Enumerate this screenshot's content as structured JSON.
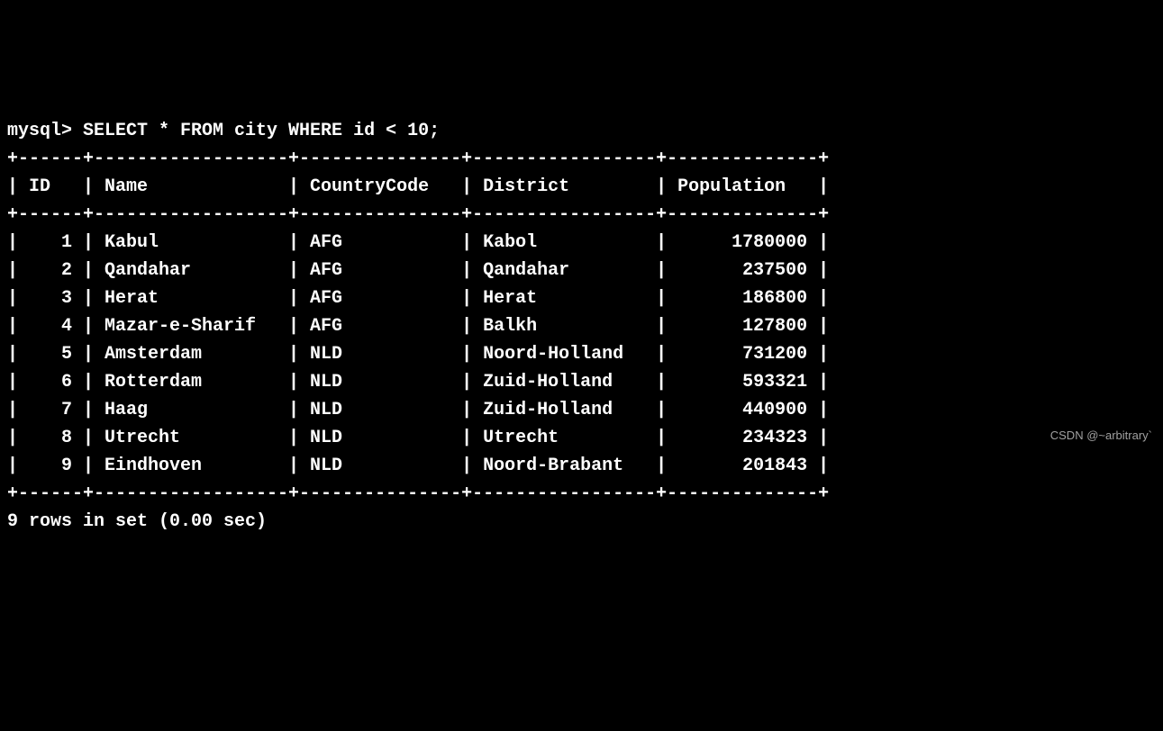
{
  "prompt": "mysql> ",
  "query": "SELECT * FROM city WHERE id < 10;",
  "columns": [
    "ID",
    "Name",
    "CountryCode",
    "District",
    "Population"
  ],
  "rows": [
    {
      "ID": "1",
      "Name": "Kabul",
      "CountryCode": "AFG",
      "District": "Kabol",
      "Population": "1780000"
    },
    {
      "ID": "2",
      "Name": "Qandahar",
      "CountryCode": "AFG",
      "District": "Qandahar",
      "Population": "237500"
    },
    {
      "ID": "3",
      "Name": "Herat",
      "CountryCode": "AFG",
      "District": "Herat",
      "Population": "186800"
    },
    {
      "ID": "4",
      "Name": "Mazar-e-Sharif",
      "CountryCode": "AFG",
      "District": "Balkh",
      "Population": "127800"
    },
    {
      "ID": "5",
      "Name": "Amsterdam",
      "CountryCode": "NLD",
      "District": "Noord-Holland",
      "Population": "731200"
    },
    {
      "ID": "6",
      "Name": "Rotterdam",
      "CountryCode": "NLD",
      "District": "Zuid-Holland",
      "Population": "593321"
    },
    {
      "ID": "7",
      "Name": "Haag",
      "CountryCode": "NLD",
      "District": "Zuid-Holland",
      "Population": "440900"
    },
    {
      "ID": "8",
      "Name": "Utrecht",
      "CountryCode": "NLD",
      "District": "Utrecht",
      "Population": "234323"
    },
    {
      "ID": "9",
      "Name": "Eindhoven",
      "CountryCode": "NLD",
      "District": "Noord-Brabant",
      "Population": "201843"
    }
  ],
  "column_widths": {
    "ID": 4,
    "Name": 16,
    "CountryCode": 13,
    "District": 15,
    "Population": 12
  },
  "column_align": {
    "ID": "right",
    "Name": "left",
    "CountryCode": "left",
    "District": "left",
    "Population": "right"
  },
  "summary": "9 rows in set (0.00 sec)",
  "watermark": "CSDN @~arbitrary`",
  "chart_data": {
    "type": "table",
    "title": "city (id < 10)",
    "columns": [
      "ID",
      "Name",
      "CountryCode",
      "District",
      "Population"
    ],
    "rows": [
      [
        1,
        "Kabul",
        "AFG",
        "Kabol",
        1780000
      ],
      [
        2,
        "Qandahar",
        "AFG",
        "Qandahar",
        237500
      ],
      [
        3,
        "Herat",
        "AFG",
        "Herat",
        186800
      ],
      [
        4,
        "Mazar-e-Sharif",
        "AFG",
        "Balkh",
        127800
      ],
      [
        5,
        "Amsterdam",
        "NLD",
        "Noord-Holland",
        731200
      ],
      [
        6,
        "Rotterdam",
        "NLD",
        "Zuid-Holland",
        593321
      ],
      [
        7,
        "Haag",
        "NLD",
        "Zuid-Holland",
        440900
      ],
      [
        8,
        "Utrecht",
        "NLD",
        "Utrecht",
        234323
      ],
      [
        9,
        "Eindhoven",
        "NLD",
        "Noord-Brabant",
        201843
      ]
    ]
  }
}
